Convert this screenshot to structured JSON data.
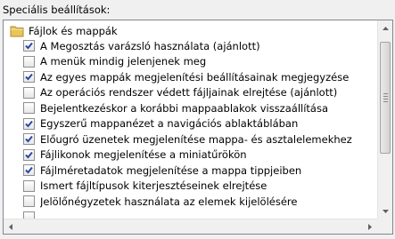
{
  "section": {
    "label": "Speciális beállítások:"
  },
  "tree": {
    "folder": {
      "label": "Fájlok és mappák",
      "icon": "folder-icon"
    },
    "items": [
      {
        "label": "A Megosztás varázsló használata (ajánlott)",
        "checked": true
      },
      {
        "label": "A menük mindig jelenjenek meg",
        "checked": false
      },
      {
        "label": "Az egyes mappák megjelenítési beállításainak megjegyzése",
        "checked": true
      },
      {
        "label": "Az operációs rendszer védett fájljainak elrejtése (ajánlott)",
        "checked": false
      },
      {
        "label": "Bejelentkezéskor a korábbi mappaablakok visszaállítása",
        "checked": false
      },
      {
        "label": "Egyszerű mappanézet a navigációs ablaktáblában",
        "checked": true
      },
      {
        "label": "Előugró üzenetek megjelenítése mappa- és asztalelemekhez",
        "checked": true
      },
      {
        "label": "Fájlikonok megjelenítése a miniatűrökön",
        "checked": true
      },
      {
        "label": "Fájlméretadatok megjelenítése a mappa tippjeiben",
        "checked": true
      },
      {
        "label": "Ismert fájltípusok kiterjesztéseinek elrejtése",
        "checked": false
      },
      {
        "label": "Jelölőnégyzetek használata az elemek kijelölésére",
        "checked": false
      },
      {
        "label": "",
        "checked": false
      }
    ]
  },
  "colors": {
    "checkmark": "#2a47a8",
    "folder": "#e8c65a"
  }
}
